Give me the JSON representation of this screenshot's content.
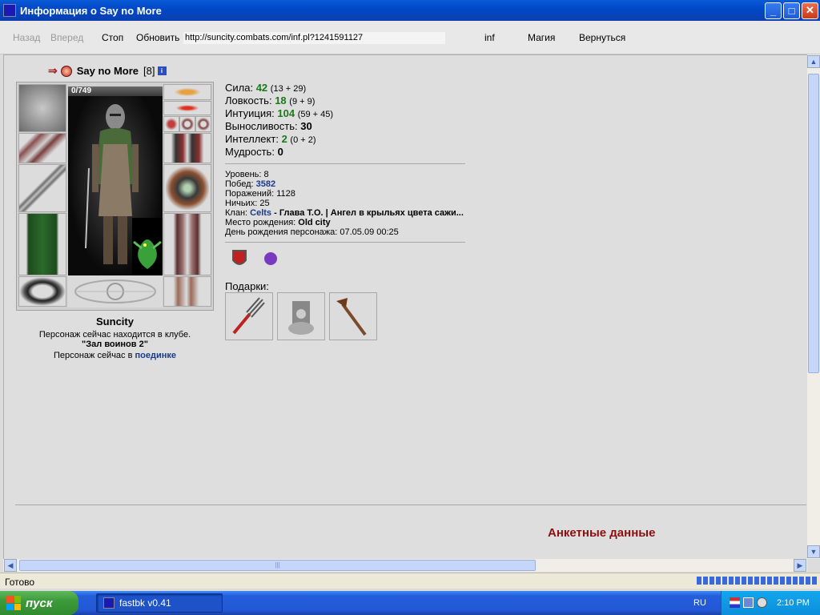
{
  "window": {
    "title": "Информация о Say no More",
    "minimize": "_",
    "maximize": "□",
    "close": "✕"
  },
  "toolbar": {
    "back": "Назад",
    "forward": "Вперед",
    "stop": "Стоп",
    "refresh": "Обновить",
    "url": "http://suncity.combats.com/inf.pl?1241591127",
    "inf": "inf",
    "magic": "Магия",
    "return": "Вернуться"
  },
  "character": {
    "name": "Say no More",
    "level": "[8]",
    "info_badge": "i",
    "hp": "0/749",
    "city": "Suncity",
    "location_line1": "Персонаж сейчас находится в клубе.",
    "location_line2": "\"Зал воинов 2\"",
    "duel_prefix": "Персонаж сейчас в",
    "duel_link": "поединке"
  },
  "stats": [
    {
      "label": "Сила:",
      "value": "42",
      "bonus": "(13 + 29)",
      "green": true
    },
    {
      "label": "Ловкость:",
      "value": "18",
      "bonus": "(9 + 9)",
      "green": true
    },
    {
      "label": "Интуиция:",
      "value": "104",
      "bonus": "(59 + 45)",
      "green": true
    },
    {
      "label": "Выносливость:",
      "value": "30",
      "bonus": "",
      "green": false
    },
    {
      "label": "Интеллект:",
      "value": "2",
      "bonus": "(0 + 2)",
      "green": true
    },
    {
      "label": "Мудрость:",
      "value": "0",
      "bonus": "",
      "green": false
    }
  ],
  "info": {
    "level_label": "Уровень:",
    "level": "8",
    "wins_label": "Побед:",
    "wins": "3582",
    "losses_label": "Поражений:",
    "losses": "1128",
    "draws_label": "Ничьих:",
    "draws": "25",
    "clan_label": "Клан:",
    "clan": "Celts",
    "clan_title": "- Глава Т.О. | Ангел в крыльях цвета сажи...",
    "birthplace_label": "Место рождения:",
    "birthplace": "Old city",
    "birthday_label": "День рождения персонажа:",
    "birthday": "07.05.09 00:25"
  },
  "gifts_label": "Подарки:",
  "anket": "Анкетные данные",
  "status": {
    "text": "Готово"
  },
  "taskbar": {
    "start": "пуск",
    "task": "fastbk v0.41",
    "lang": "RU",
    "clock": "2:10 PM"
  },
  "icons": [
    "arrow-icon",
    "clan-emblem-icon",
    "info-icon",
    "medal-icon",
    "gift-icon"
  ]
}
